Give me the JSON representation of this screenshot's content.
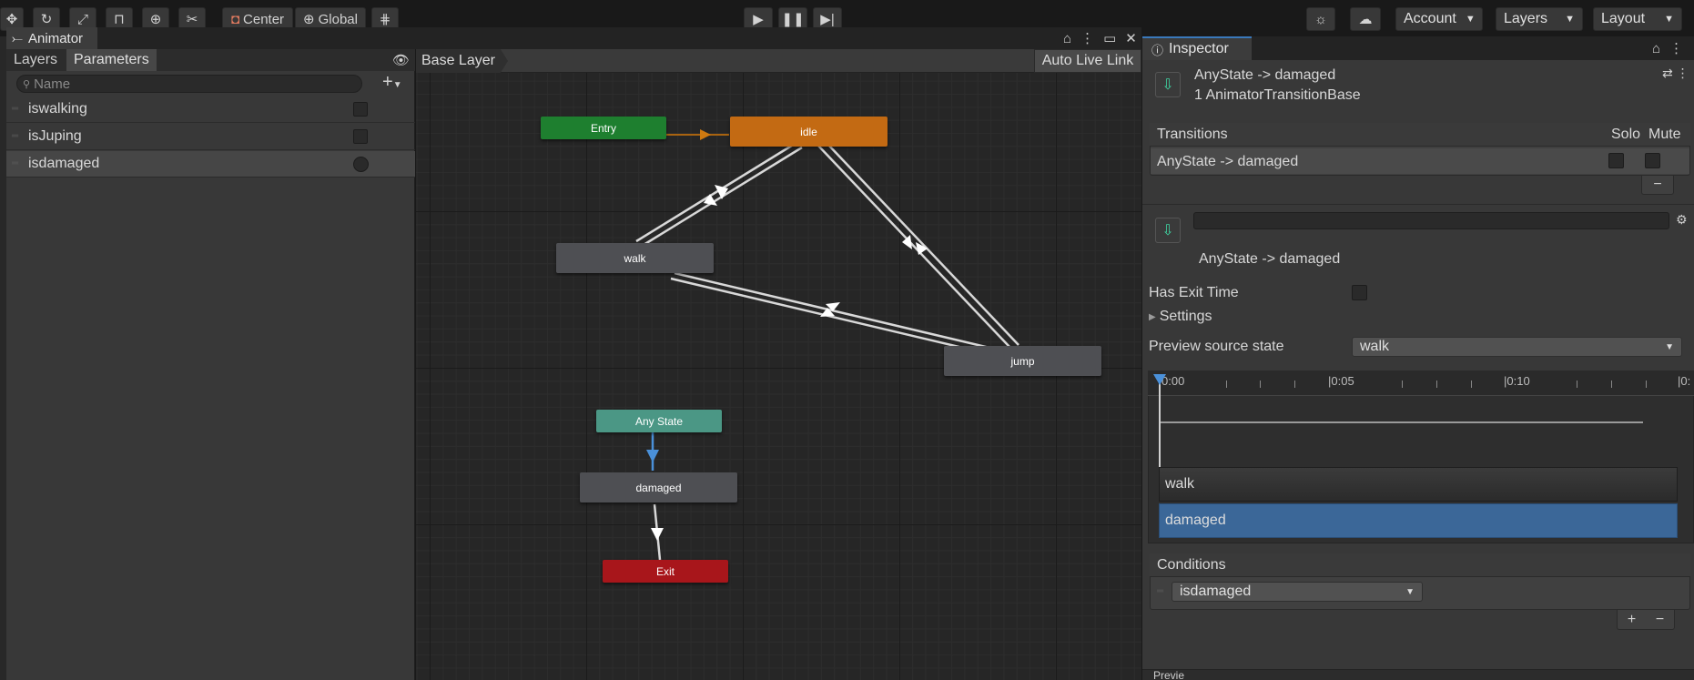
{
  "toolbar": {
    "center_label": "Center",
    "global_label": "Global",
    "account_label": "Account",
    "layers_label": "Layers",
    "layout_label": "Layout",
    "tool_icons": [
      "move-tool-icon",
      "rotate-tool-icon",
      "scale-tool-icon",
      "rect-tool-icon",
      "transform-tool-icon",
      "custom-tool-icon"
    ]
  },
  "animator": {
    "window_title": "Animator",
    "tabs": {
      "layers": "Layers",
      "parameters": "Parameters"
    },
    "search_placeholder": "Name",
    "parameters": [
      {
        "name": "iswalking",
        "type": "bool"
      },
      {
        "name": "isJuping",
        "type": "bool"
      },
      {
        "name": "isdamaged",
        "type": "trigger"
      }
    ],
    "breadcrumb": "Base Layer",
    "auto_live_link": "Auto Live Link",
    "states": {
      "entry": "Entry",
      "idle": "idle",
      "walk": "walk",
      "jump": "jump",
      "any_state": "Any State",
      "damaged": "damaged",
      "exit": "Exit"
    },
    "colors": {
      "entry": "#1e7f2f",
      "idle": "#c36a13",
      "normal": "#4e4f53",
      "any_state": "#4b9785",
      "exit": "#a8161b",
      "selected_transition": "#4a90d9"
    }
  },
  "inspector": {
    "tab_label": "Inspector",
    "header_title": "AnyState -> damaged",
    "header_subtitle": "1 AnimatorTransitionBase",
    "transitions_header": "Transitions",
    "solo_label": "Solo",
    "mute_label": "Mute",
    "transition_row": "AnyState -> damaged",
    "minus_label": "−",
    "transition_name_value": "",
    "transition_caption": "AnyState -> damaged",
    "has_exit_time_label": "Has Exit Time",
    "settings_label": "Settings",
    "preview_source_label": "Preview source state",
    "preview_source_value": "walk",
    "timeline_labels": [
      "0:00",
      "|0:05",
      "|0:10",
      "|0:"
    ],
    "clips": {
      "source": "walk",
      "target": "damaged"
    },
    "conditions_header": "Conditions",
    "condition_param": "isdamaged",
    "add_label": "+",
    "remove_label": "−",
    "bottom_label": "Previe"
  }
}
